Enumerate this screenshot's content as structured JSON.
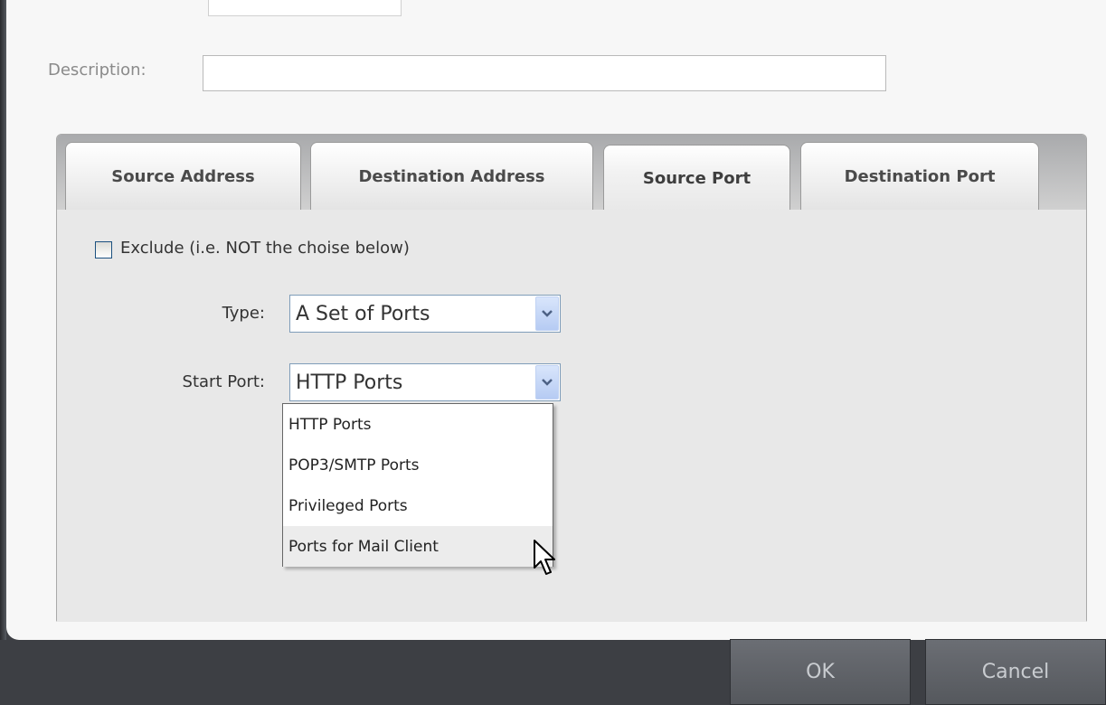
{
  "description": {
    "label": "Description:",
    "value": ""
  },
  "tabs": [
    {
      "label": "Source Address",
      "active": false
    },
    {
      "label": "Destination Address",
      "active": false
    },
    {
      "label": "Source Port",
      "active": true
    },
    {
      "label": "Destination Port",
      "active": false
    }
  ],
  "exclude": {
    "label": "Exclude (i.e. NOT the choise below)",
    "checked": false
  },
  "type_field": {
    "label": "Type:",
    "value": "A Set of Ports"
  },
  "start_port_field": {
    "label": "Start Port:",
    "value": "HTTP Ports",
    "options": [
      "HTTP Ports",
      "POP3/SMTP Ports",
      "Privileged Ports",
      "Ports for Mail Client"
    ],
    "hovered_option": "Ports for Mail Client"
  },
  "footer": {
    "ok_label": "OK",
    "cancel_label": "Cancel"
  },
  "colors": {
    "background": "#3d3f44",
    "panel": "#e8e8e8",
    "dropdown_button": "#b6cbf3"
  }
}
